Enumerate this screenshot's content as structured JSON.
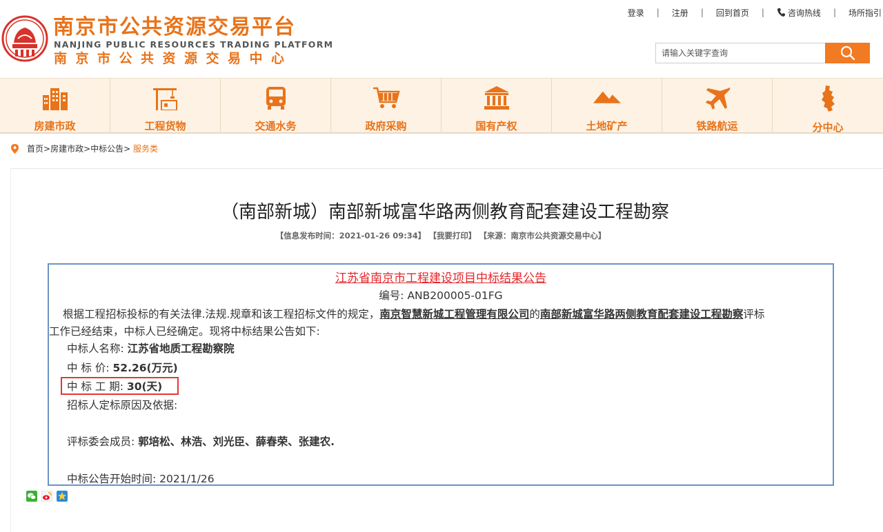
{
  "header": {
    "logo_title": "南京市公共资源交易平台",
    "logo_en": "NANJING PUBLIC RESOURCES TRADING PLATFORM",
    "logo_sub": "南京市公共资源交易中心",
    "top_links": [
      "登录",
      "注册",
      "回到首页",
      "咨询热线",
      "场所指引"
    ],
    "search_placeholder": "请输入关键字查询"
  },
  "nav": {
    "items": [
      {
        "label": "房建市政",
        "icon": "buildings-icon"
      },
      {
        "label": "工程货物",
        "icon": "crane-icon"
      },
      {
        "label": "交通水务",
        "icon": "bus-icon"
      },
      {
        "label": "政府采购",
        "icon": "cart-icon"
      },
      {
        "label": "国有产权",
        "icon": "bank-icon"
      },
      {
        "label": "土地矿产",
        "icon": "mountain-icon"
      },
      {
        "label": "铁路航运",
        "icon": "airplane-icon"
      },
      {
        "label": "分中心",
        "icon": "map-icon"
      }
    ]
  },
  "breadcrumb": {
    "items": [
      "首页",
      "房建市政",
      "中标公告"
    ],
    "current": "服务类"
  },
  "article": {
    "title": "（南部新城）南部新城富华路两侧教育配套建设工程勘察",
    "meta_time": "【信息发布时间：2021-01-26 09:34】",
    "meta_print": "【我要打印】",
    "meta_source": "【来源：南京市公共资源交易中心】"
  },
  "notice": {
    "title": "江苏省南京市工程建设项目中标结果公告",
    "code": "编号: ANB200005-01FG",
    "para_prefix": "根据工程招标投标的有关法律.法规.规章和该工程招标文件的规定，",
    "tenderer": "南京智慧新城工程管理有限公司",
    "para_of": "的",
    "project": "南部新城富华路两侧教育配套建设工程勘察",
    "para_suffix": "评标",
    "para_line2": "工作已经结束，中标人已经确定。现将中标结果公告如下:",
    "winner_label": "中标人名称: ",
    "winner_value": "江苏省地质工程勘察院",
    "price_label": "中 标 价: ",
    "price_value": "52.26(万元)",
    "period_label": "中 标 工 期: ",
    "period_value": "30(天)",
    "reason_label": "招标人定标原因及依据:",
    "committee_label": "评标委会成员: ",
    "committee_value": "郭培松、林浩、刘光臣、薛春荣、张建农.",
    "start_label": "中标公告开始时间:  ",
    "start_value": "2021/1/26"
  },
  "colors": {
    "brand_orange": "#e8731a",
    "search_button": "#f27a22",
    "notice_border": "#6a93c5",
    "notice_title": "#e4272b",
    "highlight": "#e53535"
  }
}
